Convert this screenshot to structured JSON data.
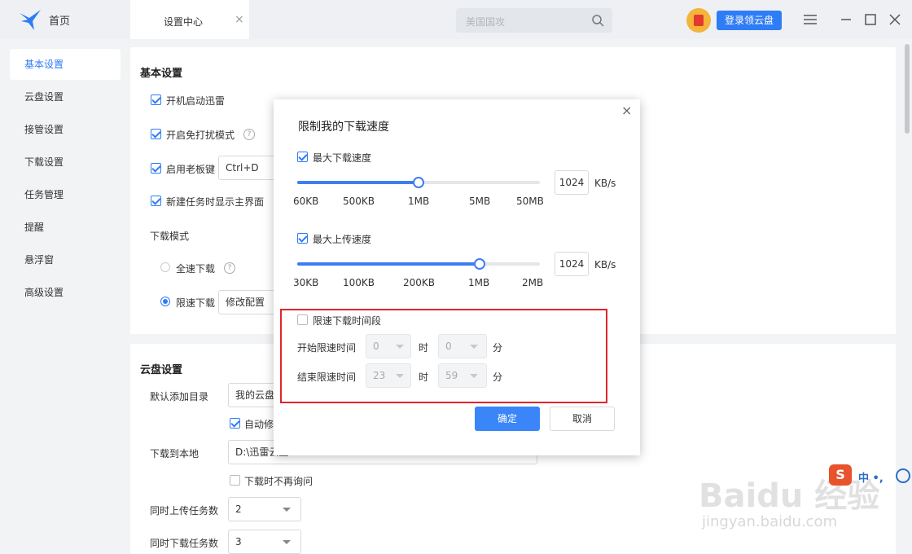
{
  "titlebar": {
    "home_label": "首页",
    "active_tab": "设置中心",
    "tab_close": "×",
    "search_placeholder": "美国国攻",
    "login_label": "登录领云盘"
  },
  "sidebar": {
    "items": [
      {
        "label": "基本设置",
        "active": true
      },
      {
        "label": "云盘设置"
      },
      {
        "label": "接管设置"
      },
      {
        "label": "下载设置"
      },
      {
        "label": "任务管理"
      },
      {
        "label": "提醒"
      },
      {
        "label": "悬浮窗"
      },
      {
        "label": "高级设置"
      }
    ]
  },
  "basic": {
    "title": "基本设置",
    "opt_startup": "开机启动迅雷",
    "opt_dnd": "开启免打扰模式",
    "opt_bosskey": "启用老板键",
    "bosskey_value": "Ctrl+D",
    "opt_show_main": "新建任务时显示主界面",
    "download_mode_label": "下载模式",
    "mode_full": "全速下载",
    "mode_limit": "限速下载",
    "modify_config": "修改配置"
  },
  "cloud": {
    "title": "云盘设置",
    "default_dir_label": "默认添加目录",
    "default_dir_value": "我的云盘",
    "auto_modify": "自动修",
    "download_local_label": "下载到本地",
    "download_local_value": "D:\\迅雷云盘",
    "no_ask": "下载时不再询问",
    "upload_tasks_label": "同时上传任务数",
    "upload_tasks_value": "2",
    "download_tasks_label": "同时下载任务数",
    "download_tasks_value": "3"
  },
  "dialog": {
    "title": "限制我的下载速度",
    "close": "×",
    "max_download_label": "最大下载速度",
    "max_download_value": "1024",
    "download_fraction": 0.5,
    "download_ticks": [
      "60KB",
      "500KB",
      "1MB",
      "5MB",
      "50MB"
    ],
    "unit": "KB/s",
    "max_upload_label": "最大上传速度",
    "max_upload_value": "1024",
    "upload_fraction": 0.75,
    "upload_ticks": [
      "30KB",
      "100KB",
      "200KB",
      "1MB",
      "2MB"
    ],
    "time_limit_label": "限速下载时间段",
    "start_label": "开始限速时间",
    "start_hour": "0",
    "start_min": "0",
    "end_label": "结束限速时间",
    "end_hour": "23",
    "end_min": "59",
    "hour_unit": "时",
    "min_unit": "分",
    "confirm": "确定",
    "cancel": "取消"
  },
  "overlay": {
    "ime_text": "中 •,",
    "watermark": "Baidu 经验",
    "watermark_sub": "jingyan.baidu.com"
  },
  "colors": {
    "accent": "#2e7cf6",
    "highlight_box": "#e0252b"
  }
}
